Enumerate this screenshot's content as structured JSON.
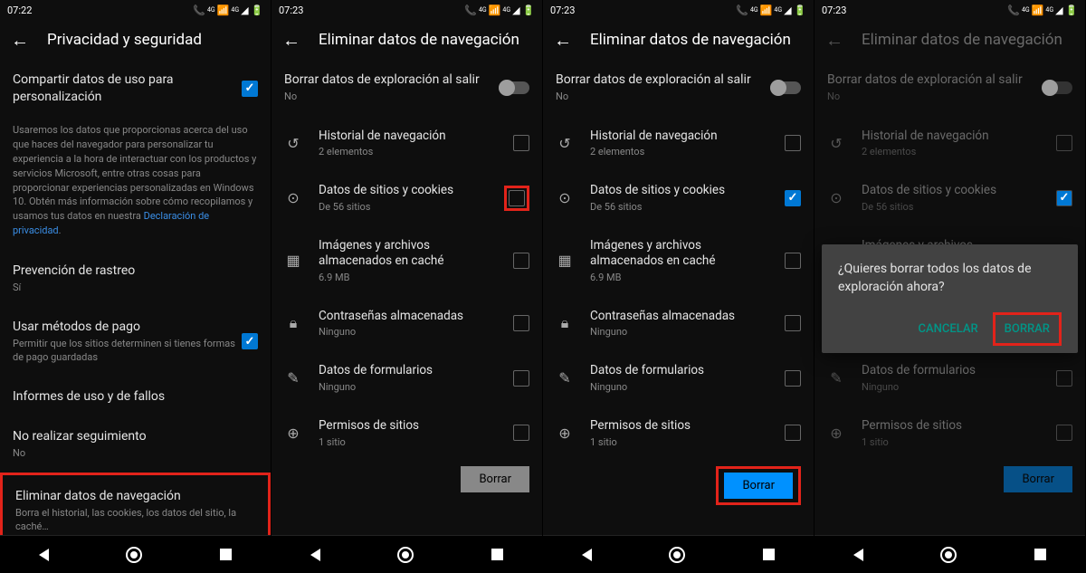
{
  "status": {
    "time1": "07:22",
    "time2": "07:23",
    "net": "4G"
  },
  "screen1": {
    "title": "Privacidad y seguridad",
    "share": {
      "title": "Compartir datos de uso para personalización"
    },
    "desc": "Usaremos los datos que proporcionas acerca del uso que haces del navegador para personalizar tu experiencia a la hora de interactuar con los productos y servicios Microsoft, entre otras cosas para proporcionar experiencias personalizadas en Windows 10. Obtén más información sobre cómo recopilamos y usamos tus datos en nuestra ",
    "desc_link": "Declaración de privacidad",
    "tracking": {
      "title": "Prevención de rastreo",
      "sub": "Sí"
    },
    "payment": {
      "title": "Usar métodos de pago",
      "sub": "Permitir que los sitios determinen si tienes formas de pago guardadas"
    },
    "reports": {
      "title": "Informes de uso y de fallos"
    },
    "dnt": {
      "title": "No realizar seguimiento",
      "sub": "No"
    },
    "clear": {
      "title": "Eliminar datos de navegación",
      "sub": "Borra el historial, las cookies, los datos del sitio, la caché…"
    }
  },
  "clearScreen": {
    "title": "Eliminar datos de navegación",
    "exit": {
      "title": "Borrar datos de exploración al salir",
      "sub": "No"
    },
    "items": [
      {
        "title": "Historial de navegación",
        "sub": "2 elementos"
      },
      {
        "title": "Datos de sitios y cookies",
        "sub": "De 56 sitios"
      },
      {
        "title": "Imágenes y archivos almacenados en caché",
        "sub": "6.9 MB"
      },
      {
        "title": "Contraseñas almacenadas",
        "sub": "Ninguno"
      },
      {
        "title": "Datos de formularios",
        "sub": "Ninguno"
      },
      {
        "title": "Permisos de sitios",
        "sub": "1 sitio"
      }
    ],
    "btn": "Borrar"
  },
  "dialog": {
    "text": "¿Quieres borrar todos los datos de exploración ahora?",
    "cancel": "CANCELAR",
    "confirm": "BORRAR"
  }
}
